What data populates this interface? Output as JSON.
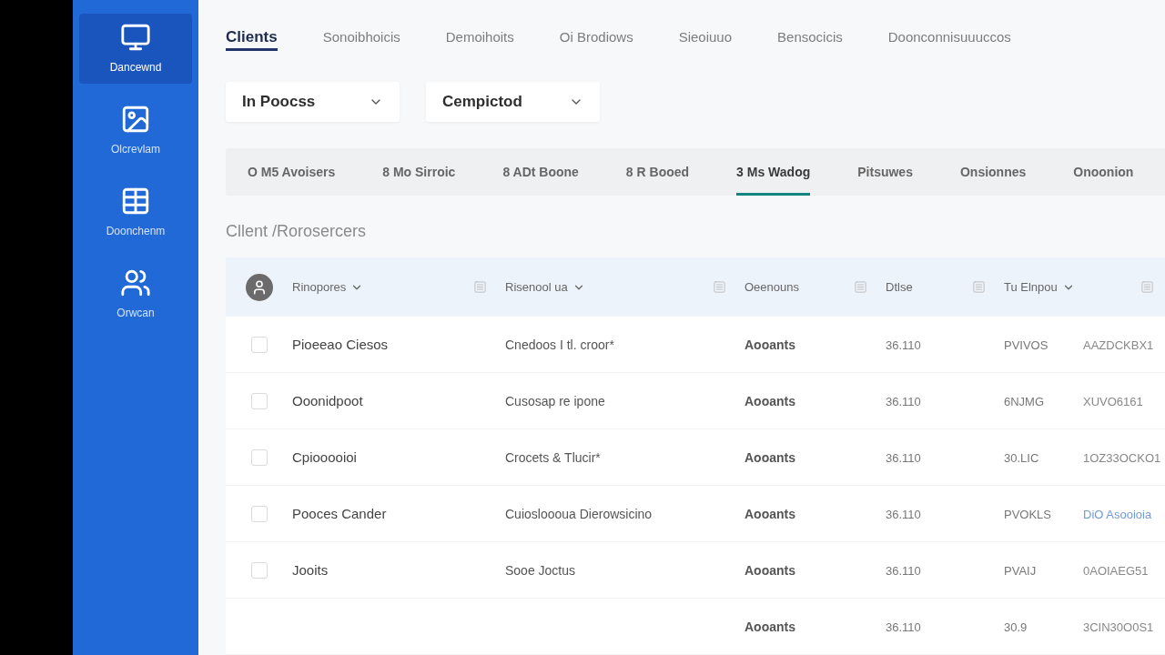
{
  "sidebar": {
    "items": [
      {
        "label": "Dancewnd",
        "selected": true
      },
      {
        "label": "Olcrevlam",
        "selected": false
      },
      {
        "label": "Doonchenm",
        "selected": false
      },
      {
        "label": "Orwcan",
        "selected": false
      }
    ]
  },
  "top_tabs": [
    {
      "label": "Clients",
      "selected": true
    },
    {
      "label": "Sonoibhoicis",
      "selected": false
    },
    {
      "label": "Demoihoits",
      "selected": false
    },
    {
      "label": "Oi Brodiows",
      "selected": false
    },
    {
      "label": "Sieoiuuo",
      "selected": false
    },
    {
      "label": "Bensocicis",
      "selected": false
    },
    {
      "label": "Doonconnisuuuccos",
      "selected": false
    }
  ],
  "filters": [
    {
      "value": "In Poocss"
    },
    {
      "value": "Cempictod"
    }
  ],
  "status_tabs": [
    {
      "label": "O M5 Avoisers",
      "selected": false
    },
    {
      "label": "8 Mo Sirroic",
      "selected": false
    },
    {
      "label": "8 ADt Boone",
      "selected": false
    },
    {
      "label": "8 R Booed",
      "selected": false
    },
    {
      "label": "3 Ms Wadog",
      "selected": true
    },
    {
      "label": "Pitsuwes",
      "selected": false
    },
    {
      "label": "Onsionnes",
      "selected": false
    },
    {
      "label": "Onoonion",
      "selected": false
    }
  ],
  "breadcrumb": "Cllent /Rorosercers",
  "table": {
    "columns": [
      {
        "label": "Rinopores",
        "dropdown": true
      },
      {
        "label": "Risenool ua",
        "dropdown": true
      },
      {
        "label": "Oeenouns",
        "dropdown": false
      },
      {
        "label": "Dtlse",
        "dropdown": false
      },
      {
        "label": "Tu Elnpou",
        "dropdown": true
      }
    ],
    "rows": [
      {
        "checked": false,
        "column_1": "Pioeeao Ciesos",
        "column_2": "Cnedoos I tl. croor*",
        "column_3": "Aooants",
        "column_4": "36.110",
        "column_5": "PVIVOS",
        "column_6": "AAZDCKBX1",
        "column_6_link": false
      },
      {
        "checked": false,
        "column_1": "Ooonidpoot",
        "column_2": "Cusosap re ipone",
        "column_3": "Aooants",
        "column_4": "36.110",
        "column_5": "6NJMG",
        "column_6": "XUVO6161",
        "column_6_link": false
      },
      {
        "checked": false,
        "column_1": "Cpiooooioi",
        "column_2": "Crocets & Tlucir*",
        "column_3": "Aooants",
        "column_4": "36.110",
        "column_5": "30.LIC",
        "column_6": "1OZ33OCKO1",
        "column_6_link": false
      },
      {
        "checked": false,
        "column_1": "Pooces Cander",
        "column_2": "Cuiosloooua Dierowsicino",
        "column_3": "Aooants",
        "column_4": "36.110",
        "column_5": "PVOKLS",
        "column_6": "DiO Asooioia",
        "column_6_link": true
      },
      {
        "checked": false,
        "column_1": "Jooits",
        "column_2": "Sooe Joctus",
        "column_3": "Aooants",
        "column_4": "36.110",
        "column_5": "PVAIJ",
        "column_6": "0AOIAEG51",
        "column_6_link": false
      },
      {
        "column_3": "Aooants",
        "column_4": "36.110",
        "column_5": "30.9",
        "column_6": "3CIN30O0S1",
        "column_6_link": false
      }
    ]
  }
}
